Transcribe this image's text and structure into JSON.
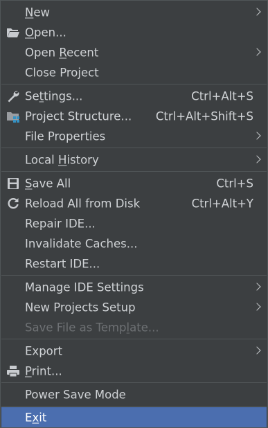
{
  "menu": {
    "new": {
      "pre": "",
      "mn": "N",
      "post": "ew"
    },
    "open": {
      "pre": "",
      "mn": "O",
      "post": "pen..."
    },
    "open_recent": {
      "pre": "Open ",
      "mn": "R",
      "post": "ecent"
    },
    "close_project": {
      "label": "Close Project"
    },
    "settings": {
      "pre": "Se",
      "mn": "t",
      "post": "tings...",
      "shortcut": "Ctrl+Alt+S"
    },
    "project_structure": {
      "label": "Project Structure...",
      "shortcut": "Ctrl+Alt+Shift+S"
    },
    "file_properties": {
      "label": "File Properties"
    },
    "local_history": {
      "pre": "Local ",
      "mn": "H",
      "post": "istory"
    },
    "save_all": {
      "pre": "",
      "mn": "S",
      "post": "ave All",
      "shortcut": "Ctrl+S"
    },
    "reload_all": {
      "label": "Reload All from Disk",
      "shortcut": "Ctrl+Alt+Y"
    },
    "repair_ide": {
      "label": "Repair IDE..."
    },
    "invalidate_caches": {
      "label": "Invalidate Caches..."
    },
    "restart_ide": {
      "label": "Restart IDE..."
    },
    "manage_ide_settings": {
      "label": "Manage IDE Settings"
    },
    "new_projects_setup": {
      "label": "New Projects Setup"
    },
    "save_file_as_template": {
      "pre": "Save File as Temp",
      "mn": "l",
      "post": "ate..."
    },
    "export": {
      "label": "Export"
    },
    "print": {
      "pre": "",
      "mn": "P",
      "post": "rint..."
    },
    "power_save_mode": {
      "label": "Power Save Mode"
    },
    "exit": {
      "pre": "E",
      "mn": "x",
      "post": "it"
    }
  },
  "icons": {
    "open": "folder-open-icon",
    "settings": "wrench-icon",
    "project_structure": "project-structure-icon",
    "save_all": "floppy-disk-icon",
    "reload_all": "reload-icon",
    "print": "printer-icon"
  },
  "colors": {
    "background": "#3c3f41",
    "text": "#d0d3d6",
    "disabled_text": "#6e7174",
    "selection": "#4b6eaf",
    "separator": "#515658",
    "accent_blue": "#3592c4"
  }
}
